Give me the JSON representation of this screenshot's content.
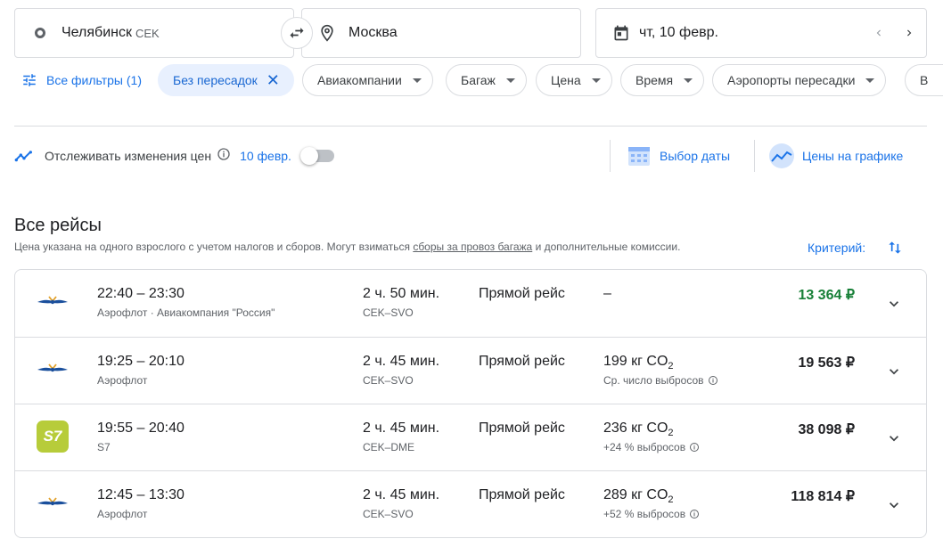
{
  "search": {
    "origin_city": "Челябинск",
    "origin_code": "CEK",
    "destination_city": "Москва",
    "date": "чт, 10 февр."
  },
  "filters": {
    "all_filters": "Все фильтры (1)",
    "nonstop": "Без пересадок",
    "chips": [
      "Авиакомпании",
      "Багаж",
      "Цена",
      "Время",
      "Аэропорты пересадки",
      "В"
    ]
  },
  "tracking": {
    "label": "Отслеживать изменения цен",
    "date": "10 февр.",
    "enabled": false
  },
  "tools": {
    "date_picker": "Выбор даты",
    "price_graph": "Цены на графике"
  },
  "results_header": {
    "title": "Все рейсы",
    "note_before": "Цена указана на одного взрослого с учетом налогов и сборов. Могут взиматься ",
    "note_link": "сборы за провоз багажа",
    "note_after": " и дополнительные комиссии.",
    "criteria": "Критерий:"
  },
  "flights": [
    {
      "times": "22:40 – 23:30",
      "carrier": "Аэрофлот · Авиакомпания \"Россия\"",
      "duration": "2 ч. 50 мин.",
      "route": "CEK–SVO",
      "stops": "Прямой рейс",
      "emissions": "–",
      "emissions_unit": "",
      "emissions_note": "",
      "price": "13 364 ₽",
      "logo": "aeroflot-logo"
    },
    {
      "times": "19:25 – 20:10",
      "carrier": "Аэрофлот",
      "duration": "2 ч. 45 мин.",
      "route": "CEK–SVO",
      "stops": "Прямой рейс",
      "emissions": "199 кг CO",
      "emissions_unit": "2",
      "emissions_note": "Ср. число выбросов",
      "price": "19 563 ₽",
      "logo": "aeroflot-logo"
    },
    {
      "times": "19:55 – 20:40",
      "carrier": "S7",
      "duration": "2 ч. 45 мин.",
      "route": "CEK–DME",
      "stops": "Прямой рейс",
      "emissions": "236 кг CO",
      "emissions_unit": "2",
      "emissions_note": "+24 % выбросов",
      "price": "38 098 ₽",
      "logo": "s7-logo",
      "logo_text": "S7"
    },
    {
      "times": "12:45 – 13:30",
      "carrier": "Аэрофлот",
      "duration": "2 ч. 45 мин.",
      "route": "CEK–SVO",
      "stops": "Прямой рейс",
      "emissions": "289 кг CO",
      "emissions_unit": "2",
      "emissions_note": "+52 % выбросов",
      "price": "118 814 ₽",
      "logo": "aeroflot-logo"
    }
  ],
  "colors": {
    "accent": "#1a73e8",
    "best_price": "#188038",
    "chip_selected_bg": "#e8f0fe",
    "s7_green": "#b7cc3a"
  }
}
